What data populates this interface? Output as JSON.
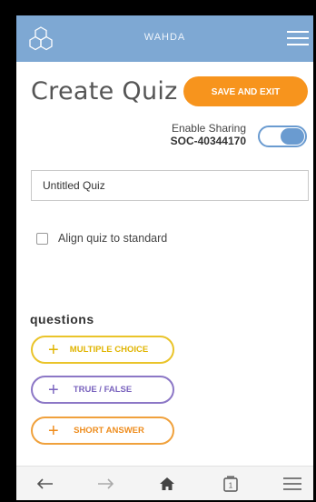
{
  "header": {
    "app_name": "WAHDA",
    "logo_icon": "hexagon-network-icon",
    "menu_icon": "hamburger-icon"
  },
  "page": {
    "title": "Create Quiz",
    "save_label": "SAVE AND EXIT"
  },
  "sharing": {
    "label": "Enable Sharing",
    "code": "SOC-40344170",
    "enabled": true
  },
  "quiz_name": {
    "value": "Untitled Quiz"
  },
  "align": {
    "label": "Align quiz to standard",
    "checked": false
  },
  "questions": {
    "heading": "questions",
    "buttons": [
      {
        "label": "MULTIPLE CHOICE",
        "icon": "plus-icon",
        "color": "#e0b400"
      },
      {
        "label": "TRUE / FALSE",
        "icon": "plus-icon",
        "color": "#7a63be"
      },
      {
        "label": "SHORT ANSWER",
        "icon": "plus-icon",
        "color": "#ee8c1c"
      }
    ]
  },
  "bottom_nav": [
    "back-arrow-icon",
    "forward-arrow-icon",
    "home-icon",
    "tabs-icon",
    "menu-icon"
  ],
  "bottom_tabs_count": "1",
  "colors": {
    "header": "#7ea8d3",
    "accent": "#f7941d",
    "toggle": "#6a9bd0"
  }
}
